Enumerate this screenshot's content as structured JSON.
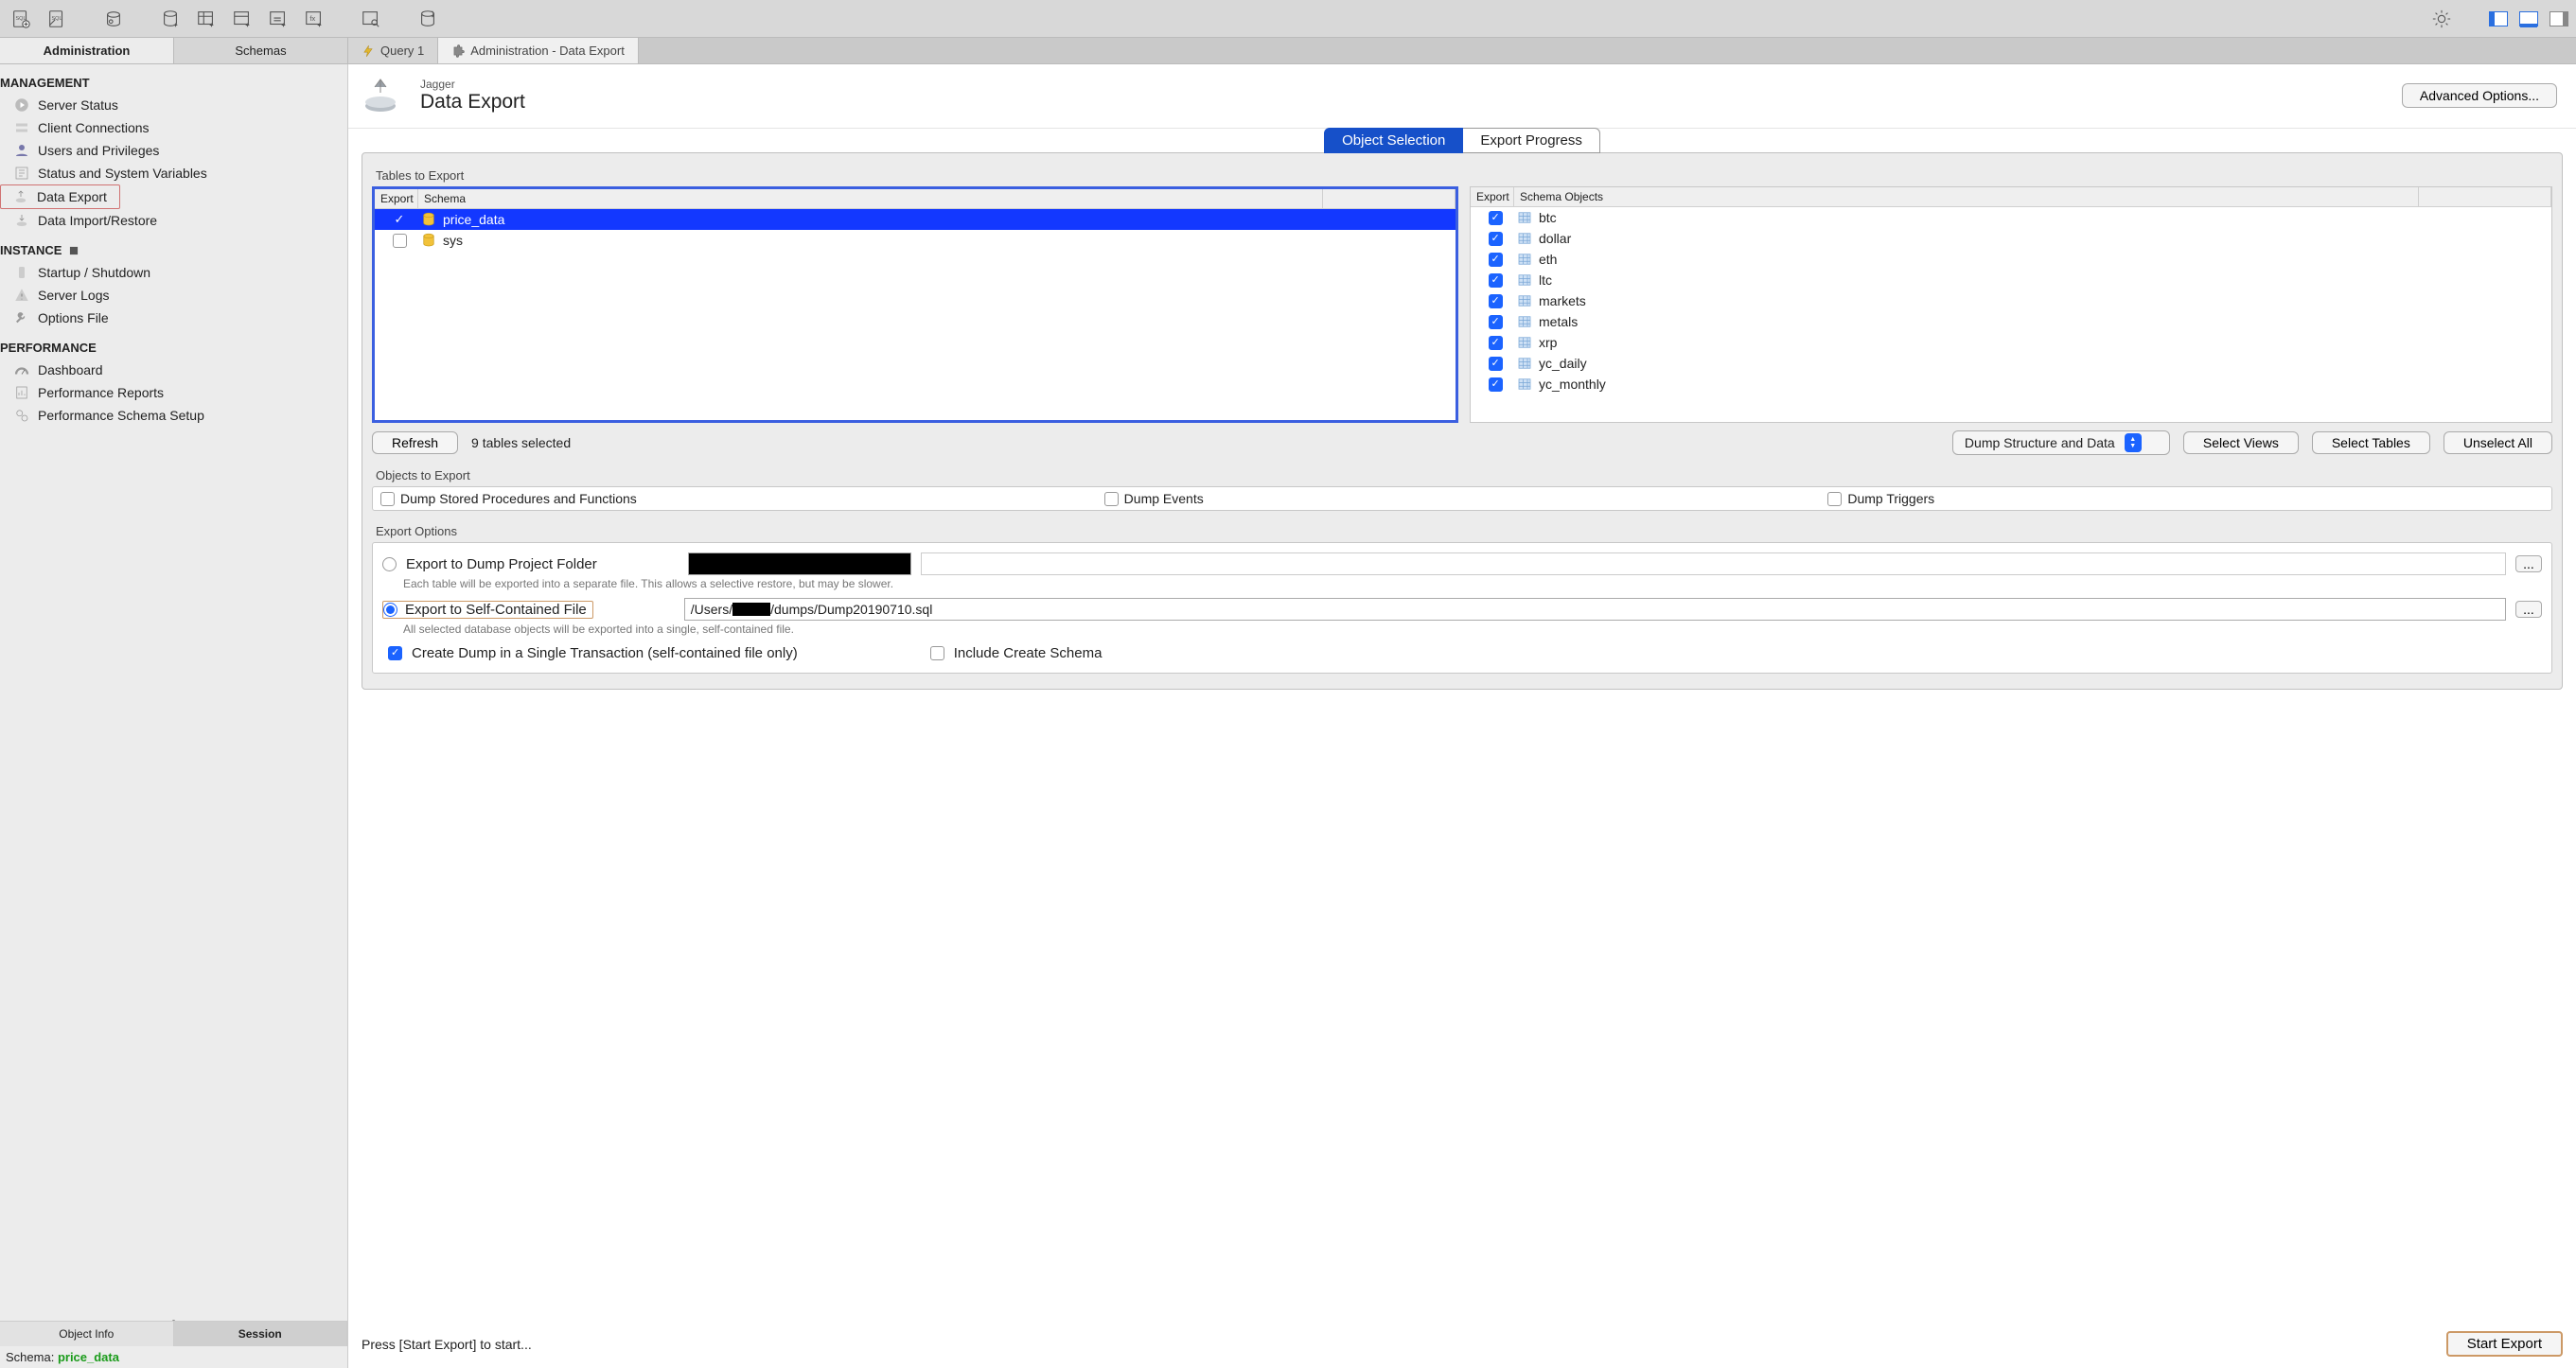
{
  "side_tabs": {
    "admin": "Administration",
    "schemas": "Schemas"
  },
  "main_tabs": {
    "query": "Query 1",
    "admin_export": "Administration - Data Export"
  },
  "sidebar": {
    "management_title": "MANAGEMENT",
    "management": [
      {
        "label": "Server Status"
      },
      {
        "label": "Client Connections"
      },
      {
        "label": "Users and Privileges"
      },
      {
        "label": "Status and System Variables"
      },
      {
        "label": "Data Export"
      },
      {
        "label": "Data Import/Restore"
      }
    ],
    "instance_title": "INSTANCE",
    "instance": [
      {
        "label": "Startup / Shutdown"
      },
      {
        "label": "Server Logs"
      },
      {
        "label": "Options File"
      }
    ],
    "perf_title": "PERFORMANCE",
    "perf": [
      {
        "label": "Dashboard"
      },
      {
        "label": "Performance Reports"
      },
      {
        "label": "Performance Schema Setup"
      }
    ],
    "bottom": {
      "object_info": "Object Info",
      "session": "Session"
    },
    "schema_label": "Schema:",
    "schema_value": "price_data"
  },
  "header": {
    "connection": "Jagger",
    "title": "Data Export",
    "advanced": "Advanced Options..."
  },
  "obj_tabs": {
    "selection": "Object Selection",
    "progress": "Export Progress"
  },
  "tables_section": {
    "label": "Tables to Export",
    "left_head": {
      "export": "Export",
      "schema": "Schema"
    },
    "schemas": [
      {
        "name": "price_data",
        "checked": true,
        "selected": true
      },
      {
        "name": "sys",
        "checked": false,
        "selected": false
      }
    ],
    "right_head": {
      "export": "Export",
      "objects": "Schema Objects"
    },
    "objects": [
      {
        "name": "btc",
        "checked": true
      },
      {
        "name": "dollar",
        "checked": true
      },
      {
        "name": "eth",
        "checked": true
      },
      {
        "name": "ltc",
        "checked": true
      },
      {
        "name": "markets",
        "checked": true
      },
      {
        "name": "metals",
        "checked": true
      },
      {
        "name": "xrp",
        "checked": true
      },
      {
        "name": "yc_daily",
        "checked": true
      },
      {
        "name": "yc_monthly",
        "checked": true
      }
    ],
    "refresh": "Refresh",
    "status": "9 tables selected",
    "dump_mode": "Dump Structure and Data",
    "select_views": "Select Views",
    "select_tables": "Select Tables",
    "unselect_all": "Unselect All"
  },
  "objects_section": {
    "label": "Objects to Export",
    "stored": "Dump Stored Procedures and Functions",
    "events": "Dump Events",
    "triggers": "Dump Triggers"
  },
  "export_options": {
    "label": "Export Options",
    "folder_label": "Export to Dump Project Folder",
    "folder_help": "Each table will be exported into a separate file. This allows a selective restore, but may be slower.",
    "self_label": "Export to Self-Contained File",
    "self_path_pre": "/Users/",
    "self_path_post": "/dumps/Dump20190710.sql",
    "self_help": "All selected database objects will be exported into a single, self-contained file.",
    "single_txn": "Create Dump in a Single Transaction (self-contained file only)",
    "include_schema": "Include Create Schema",
    "dots": "..."
  },
  "footer": {
    "hint": "Press [Start Export] to start...",
    "start": "Start Export"
  }
}
